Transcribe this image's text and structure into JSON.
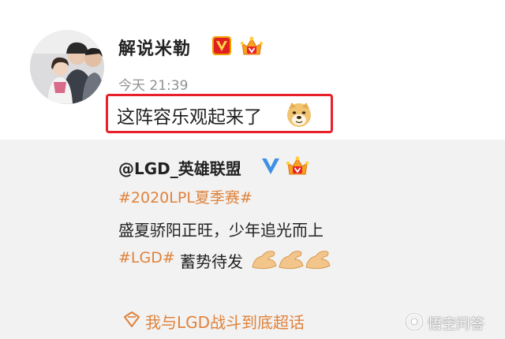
{
  "post": {
    "username": "解说米勒",
    "timestamp": "今天 21:39",
    "text": "这阵容乐观起来了"
  },
  "repost": {
    "author": "@LGD_英雄联盟",
    "hashtag1": "#2020LPL夏季赛#",
    "line2": "盛夏骄阳正旺，少年追光而上",
    "hashtag2": "#LGD#",
    "line3": "蓄势待发"
  },
  "topic": {
    "label": "我与LGD战斗到底超话"
  },
  "watermark": {
    "text": "悟空问答"
  },
  "colors": {
    "highlight_border": "#e8202a",
    "link_orange": "#e0823a",
    "repost_bg": "#f2f2f2",
    "verified_gold": "#f29c00",
    "verified_blue": "#3d8fe8"
  },
  "icons": {
    "v_badge": "verified-v-icon",
    "crown": "vip-crown-icon",
    "doge": "doge-emoji-icon",
    "muscle": "flexed-biceps-emoji-icon",
    "topic": "super-topic-icon"
  }
}
